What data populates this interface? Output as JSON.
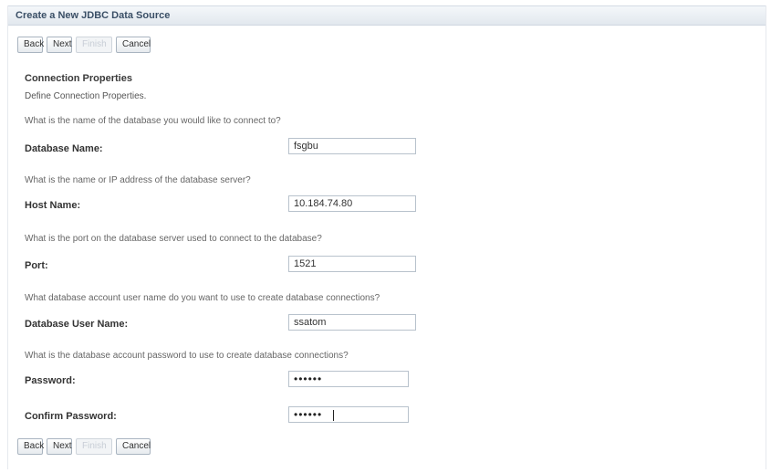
{
  "window": {
    "title": "Create a New JDBC Data Source"
  },
  "toolbar": {
    "back": "Back",
    "next": "Next",
    "finish": "Finish",
    "cancel": "Cancel"
  },
  "section": {
    "title": "Connection Properties",
    "description": "Define Connection Properties."
  },
  "fields": {
    "database_name": {
      "question": "What is the name of the database you would like to connect to?",
      "label": "Database Name:",
      "value": "fsgbu"
    },
    "host_name": {
      "question": "What is the name or IP address of the database server?",
      "label": "Host Name:",
      "value": "10.184.74.80"
    },
    "port": {
      "question": "What is the port on the database server used to connect to the database?",
      "label": "Port:",
      "value": "1521"
    },
    "db_user": {
      "question": "What database account user name do you want to use to create database connections?",
      "label": "Database User Name:",
      "value": "ssatom"
    },
    "password": {
      "question": "What is the database account password to use to create database connections?",
      "label": "Password:",
      "value": "••••••"
    },
    "confirm_password": {
      "label": "Confirm Password:",
      "value": "••••••"
    }
  }
}
